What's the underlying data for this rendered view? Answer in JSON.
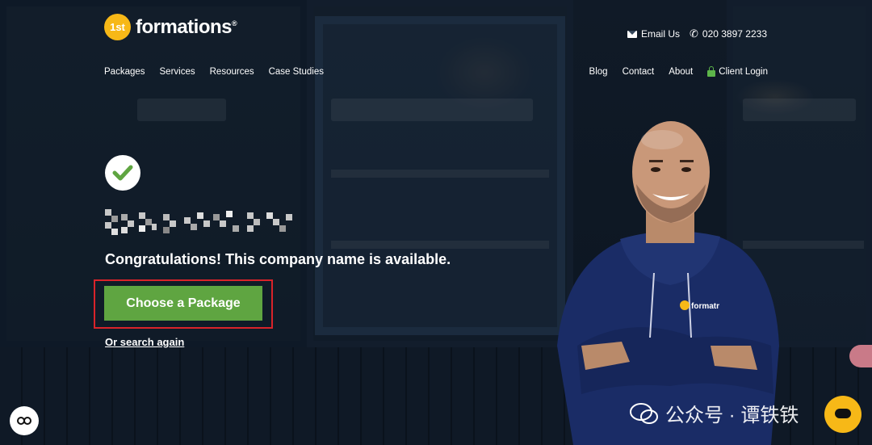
{
  "brand": {
    "badge": "1st",
    "name": "formations",
    "reg": "®"
  },
  "top_contact": {
    "email_label": "Email Us",
    "phone_label": "020 3897 2233"
  },
  "nav_left": [
    "Packages",
    "Services",
    "Resources",
    "Case Studies"
  ],
  "nav_right": {
    "blog": "Blog",
    "contact": "Contact",
    "about": "About",
    "client_login": "Client Login"
  },
  "hero": {
    "congrats": "Congratulations! This company name is available.",
    "cta_label": "Choose a Package",
    "search_again": "Or search again"
  },
  "hoodie_logo": "formatr",
  "watermark": {
    "text": "公众号 · 谭铁铁"
  },
  "colors": {
    "accent_green": "#5fa541",
    "brand_yellow": "#f7b817",
    "highlight_red": "#d9232a",
    "navy": "#0d1622"
  },
  "icons": [
    "check-icon",
    "envelope-icon",
    "phone-icon",
    "lock-icon",
    "cookie-icon",
    "chat-icon",
    "wechat-icon"
  ]
}
